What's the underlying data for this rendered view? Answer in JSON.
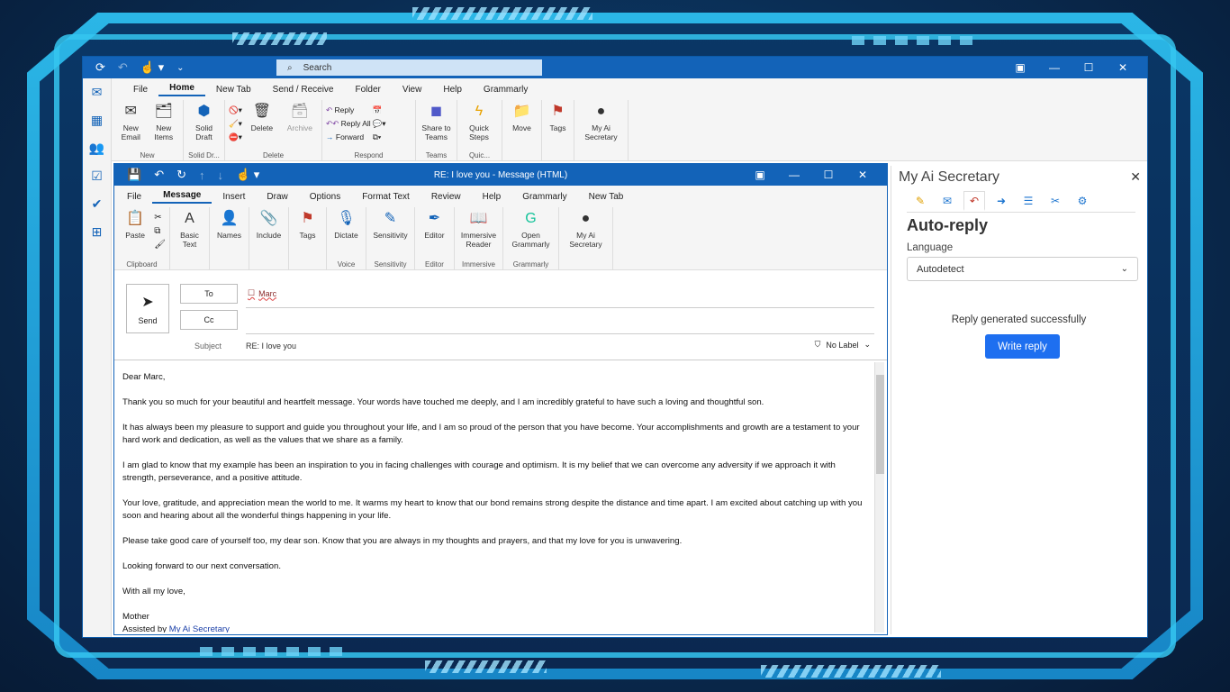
{
  "outlook": {
    "search_placeholder": "Search",
    "menu": [
      "File",
      "Home",
      "New Tab",
      "Send / Receive",
      "Folder",
      "View",
      "Help",
      "Grammarly"
    ],
    "ribbon": {
      "new_email": "New Email",
      "new_items": "New Items",
      "group_new": "New",
      "solid_draft": "Solid Draft",
      "group_solid": "Solid Dr...",
      "delete": "Delete",
      "archive": "Archive",
      "group_delete": "Delete",
      "reply": "Reply",
      "reply_all": "Reply All",
      "forward": "Forward",
      "group_respond": "Respond",
      "share_teams": "Share to Teams",
      "group_teams": "Teams",
      "quick_steps": "Quick Steps",
      "group_quick": "Quic...",
      "move": "Move",
      "tags": "Tags",
      "my_ai": "My Ai Secretary"
    }
  },
  "message": {
    "title": "RE: I love you  -  Message (HTML)",
    "menu": [
      "File",
      "Message",
      "Insert",
      "Draw",
      "Options",
      "Format Text",
      "Review",
      "Help",
      "Grammarly",
      "New Tab"
    ],
    "ribbon": {
      "paste": "Paste",
      "group_clipboard": "Clipboard",
      "basic_text": "Basic Text",
      "names": "Names",
      "include": "Include",
      "tags": "Tags",
      "dictate": "Dictate",
      "group_voice": "Voice",
      "sensitivity": "Sensitivity",
      "group_sensitivity": "Sensitivity",
      "editor": "Editor",
      "group_editor": "Editor",
      "immersive_reader": "Immersive Reader",
      "group_immersive": "Immersive",
      "open_grammarly": "Open Grammarly",
      "group_grammarly": "Grammarly",
      "my_ai": "My Ai Secretary"
    },
    "send": "Send",
    "to_label": "To",
    "cc_label": "Cc",
    "recipient": "Marc",
    "subject_label": "Subject",
    "subject": "RE: I love you",
    "no_label": "No Label",
    "body": {
      "greeting": "Dear Marc,",
      "p1": "Thank you so much for your beautiful and heartfelt message. Your words have touched me deeply, and I am incredibly grateful to have such a loving and thoughtful son.",
      "p2": "It has always been my pleasure to support and guide you throughout your life, and I am so proud of the person that you have become. Your accomplishments and growth are a testament to your hard work and dedication, as well as the values that we share as a family.",
      "p3": "I am glad to know that my example has been an inspiration to you in facing challenges with courage and optimism. It is my belief that we can overcome any adversity if we approach it with strength, perseverance, and a positive attitude.",
      "p4": "Your love, gratitude, and appreciation mean the world to me. It warms my heart to know that our bond remains strong despite the distance and time apart. I am excited about catching up with you soon and hearing about all the wonderful things happening in your life.",
      "p5": "Please take good care of yourself too, my dear son. Know that you are always in my thoughts and prayers, and that my love for you is unwavering.",
      "p6": "Looking forward to our next conversation.",
      "closing": "With all my love,",
      "signature": "Mother",
      "assisted_prefix": "Assisted by",
      "assisted_link": "My Ai Secretary"
    }
  },
  "panel": {
    "title": "My Ai Secretary",
    "heading": "Auto-reply",
    "language_label": "Language",
    "language_value": "Autodetect",
    "status": "Reply generated successfully",
    "write_reply": "Write reply"
  },
  "colors": {
    "accent": "#1363b8",
    "button": "#1e6ff0"
  }
}
